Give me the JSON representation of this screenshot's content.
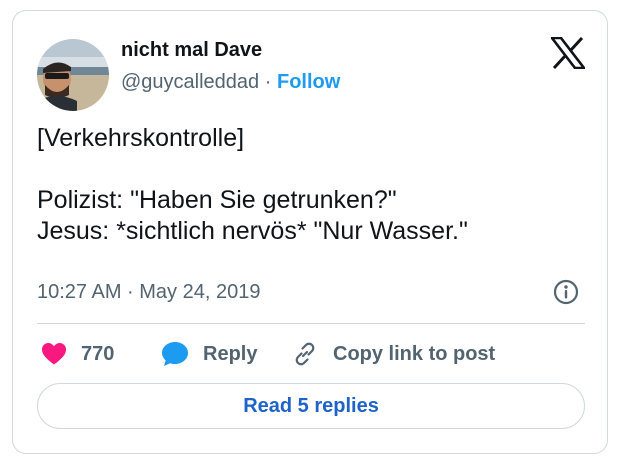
{
  "author": {
    "display_name": "nicht mal Dave",
    "handle": "@guycalleddad",
    "separator": "·",
    "follow_label": "Follow",
    "avatar_icon": "profile-photo-beach"
  },
  "brand": {
    "logo_icon": "x-logo-icon"
  },
  "tweet": {
    "text": "[Verkehrskontrolle]\n\nPolizist: \"Haben Sie getrunken?\"\nJesus: *sichtlich nervös* \"Nur Wasser.\"",
    "timestamp": "10:27 AM · May 24, 2019"
  },
  "actions": {
    "like_count": "770",
    "reply_label": "Reply",
    "copy_label": "Copy link to post",
    "read_replies_label": "Read 5 replies"
  },
  "colors": {
    "heart": "#f91880",
    "reply_bubble": "#1d9bf0",
    "link": "#1d63c9",
    "text_secondary": "#536471",
    "border": "#cfd9de"
  }
}
